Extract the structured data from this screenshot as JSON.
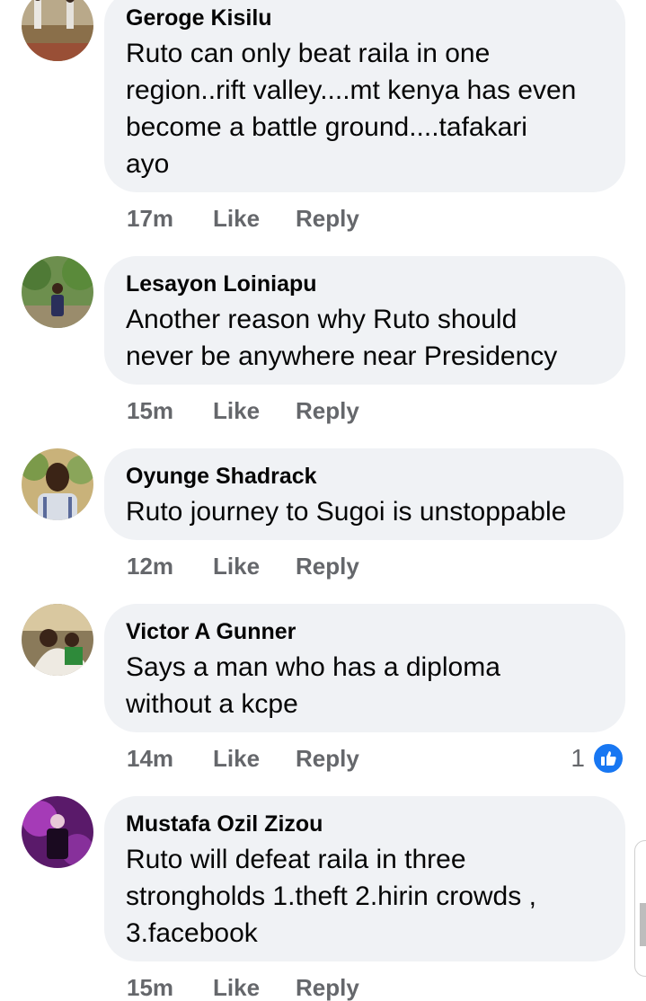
{
  "actions": {
    "like_label": "Like",
    "reply_label": "Reply"
  },
  "comments": [
    {
      "author": "Geroge Kisilu",
      "lines": [
        "Ruto can only beat raila in one",
        "region..rift valley....mt kenya has even",
        "become a battle ground....tafakari",
        "ayo"
      ],
      "time": "17m"
    },
    {
      "author": "Lesayon Loiniapu",
      "lines": [
        "Another reason why Ruto should",
        "never be anywhere near Presidency"
      ],
      "time": "15m"
    },
    {
      "author": "Oyunge Shadrack",
      "lines": [
        "Ruto journey to Sugoi is unstoppable"
      ],
      "time": "12m"
    },
    {
      "author": "Victor A Gunner",
      "lines": [
        "Says a man who has a diploma",
        "without a kcpe"
      ],
      "time": "14m",
      "reaction_count": "1"
    },
    {
      "author": "Mustafa Ozil Zizou",
      "lines": [
        "Ruto will defeat raila in three",
        "strongholds 1.theft 2.hirin crowds ,",
        "3.facebook"
      ],
      "time": "15m"
    }
  ],
  "colors": {
    "bubble": "#f0f2f5",
    "meta_text": "#65676b",
    "like_blue": "#1877f2"
  }
}
